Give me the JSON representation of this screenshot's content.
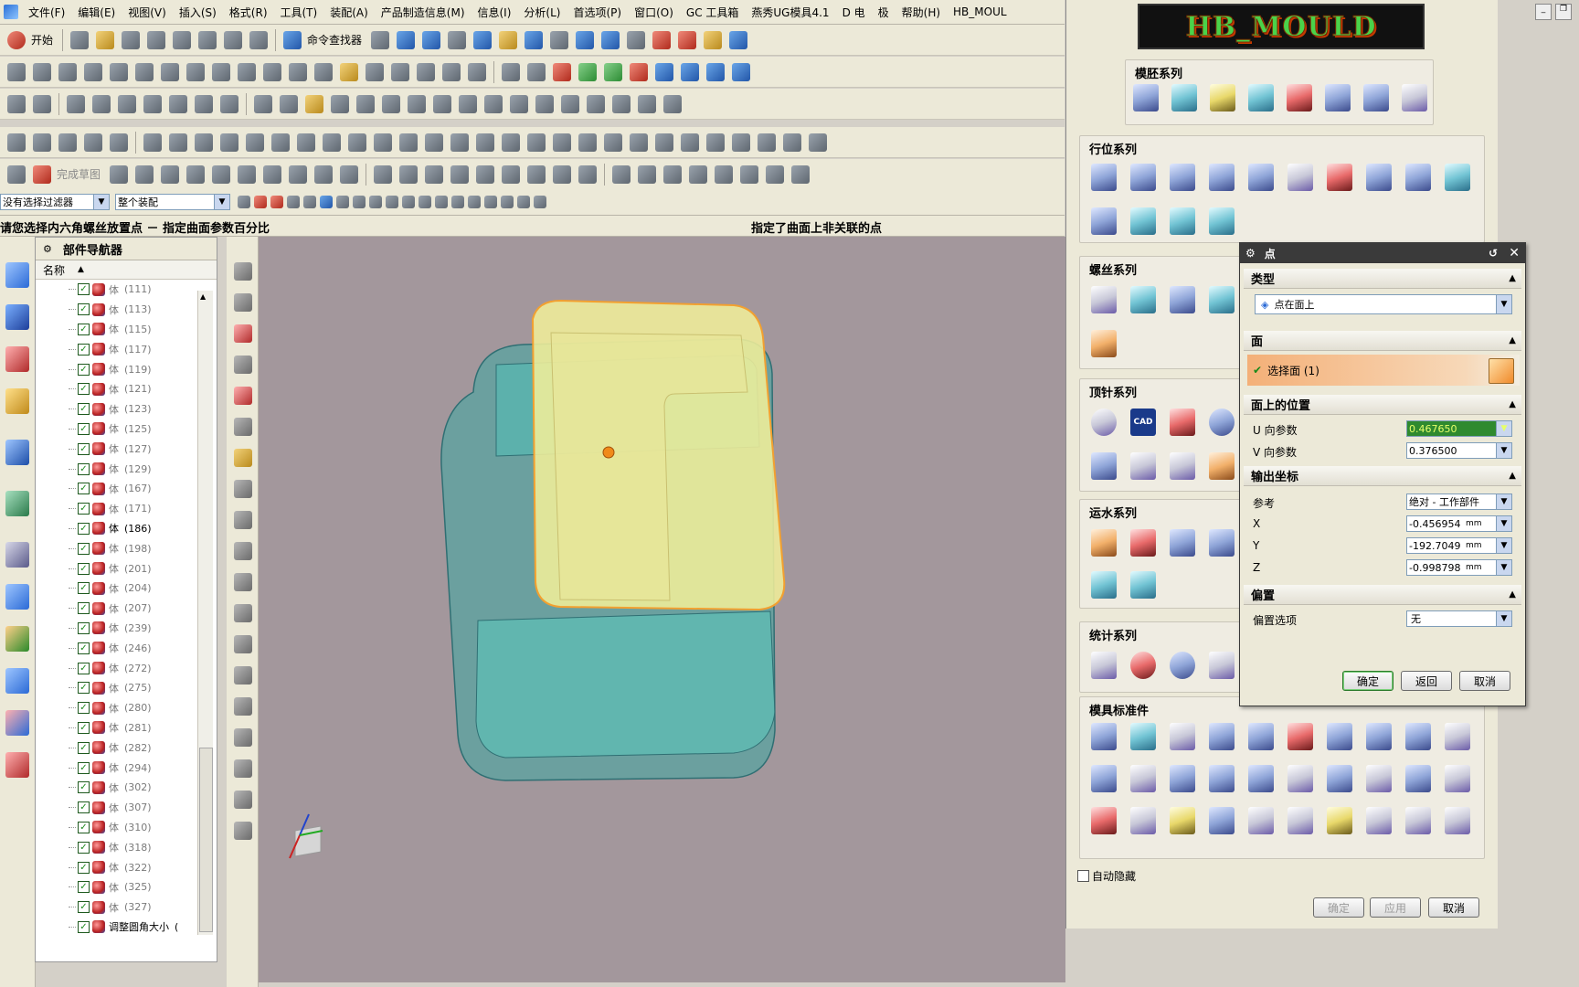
{
  "menu": {
    "items": [
      "文件(F)",
      "编辑(E)",
      "视图(V)",
      "插入(S)",
      "格式(R)",
      "工具(T)",
      "装配(A)",
      "产品制造信息(M)",
      "信息(I)",
      "分析(L)",
      "首选项(P)",
      "窗口(O)",
      "GC 工具箱",
      "燕秀UG模具4.1",
      "D 电",
      "极",
      "帮助(H)",
      "HB_MOUL"
    ]
  },
  "toolbar": {
    "start_label": "开始",
    "command_finder": "命令查找器",
    "finish_sketch": "完成草图"
  },
  "filter": {
    "selection_filter": "没有选择过滤器",
    "scope": "整个装配"
  },
  "status": {
    "prompt": "请您选择内六角螺丝放置点 － 指定曲面参数百分比",
    "message": "指定了曲面上非关联的点"
  },
  "navigator": {
    "title": "部件导航器",
    "column_name": "名称",
    "rows": [
      {
        "label": "体",
        "id": "(111)",
        "active": false
      },
      {
        "label": "体",
        "id": "(113)",
        "active": false
      },
      {
        "label": "体",
        "id": "(115)",
        "active": false
      },
      {
        "label": "体",
        "id": "(117)",
        "active": false
      },
      {
        "label": "体",
        "id": "(119)",
        "active": false
      },
      {
        "label": "体",
        "id": "(121)",
        "active": false
      },
      {
        "label": "体",
        "id": "(123)",
        "active": false
      },
      {
        "label": "体",
        "id": "(125)",
        "active": false
      },
      {
        "label": "体",
        "id": "(127)",
        "active": false
      },
      {
        "label": "体",
        "id": "(129)",
        "active": false
      },
      {
        "label": "体",
        "id": "(167)",
        "active": false
      },
      {
        "label": "体",
        "id": "(171)",
        "active": false
      },
      {
        "label": "体",
        "id": "(186)",
        "active": true
      },
      {
        "label": "体",
        "id": "(198)",
        "active": false
      },
      {
        "label": "体",
        "id": "(201)",
        "active": false
      },
      {
        "label": "体",
        "id": "(204)",
        "active": false
      },
      {
        "label": "体",
        "id": "(207)",
        "active": false
      },
      {
        "label": "体",
        "id": "(239)",
        "active": false
      },
      {
        "label": "体",
        "id": "(246)",
        "active": false
      },
      {
        "label": "体",
        "id": "(272)",
        "active": false
      },
      {
        "label": "体",
        "id": "(275)",
        "active": false
      },
      {
        "label": "体",
        "id": "(280)",
        "active": false
      },
      {
        "label": "体",
        "id": "(281)",
        "active": false
      },
      {
        "label": "体",
        "id": "(282)",
        "active": false
      },
      {
        "label": "体",
        "id": "(294)",
        "active": false
      },
      {
        "label": "体",
        "id": "(302)",
        "active": false
      },
      {
        "label": "体",
        "id": "(307)",
        "active": false
      },
      {
        "label": "体",
        "id": "(310)",
        "active": false
      },
      {
        "label": "体",
        "id": "(318)",
        "active": false
      },
      {
        "label": "体",
        "id": "(322)",
        "active": false
      },
      {
        "label": "体",
        "id": "(325)",
        "active": false
      },
      {
        "label": "体",
        "id": "(327)",
        "active": false
      },
      {
        "label": "调整圆角大小",
        "id": "(",
        "active": true
      }
    ]
  },
  "hb_panel": {
    "logo": "HB_MOULD",
    "groups": {
      "mould_base": "模胚系列",
      "slider": "行位系列",
      "screw": "螺丝系列",
      "ejector": "顶针系列",
      "cooling": "运水系列",
      "statistics": "统计系列",
      "standard_parts": "模具标准件"
    },
    "cad_label": "CAD",
    "auto_hide": "自动隐藏",
    "ok": "确定",
    "apply": "应用",
    "cancel": "取消"
  },
  "point_dialog": {
    "title": "点",
    "type_section": "类型",
    "type_value": "点在面上",
    "face_section": "面",
    "select_face": "选择面 (1)",
    "position_section": "面上的位置",
    "u_label": "U 向参数",
    "u_value": "0.467650",
    "v_label": "V 向参数",
    "v_value": "0.376500",
    "output_section": "输出坐标",
    "reference_label": "参考",
    "reference_value": "绝对 - 工作部件",
    "x_label": "X",
    "x_value": "-0.456954",
    "y_label": "Y",
    "y_value": "-192.7049",
    "z_label": "Z",
    "z_value": "-0.998798",
    "unit": "mm",
    "offset_section": "偏置",
    "offset_label": "偏置选项",
    "offset_value": "无",
    "ok": "确定",
    "back": "返回",
    "cancel": "取消"
  }
}
